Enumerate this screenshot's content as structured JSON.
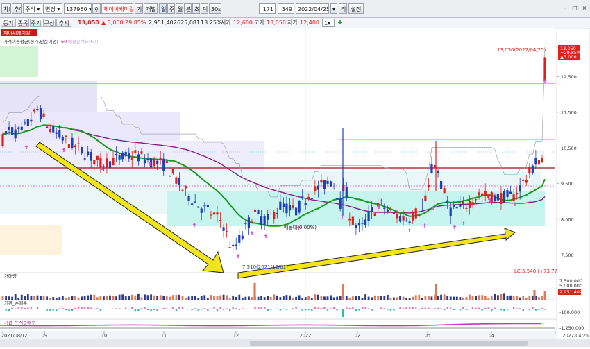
{
  "toolbar": {
    "left_buttons": [
      "차트",
      "추이"
    ],
    "market_select": "주식",
    "change_select": "변경",
    "code": "137950",
    "company": "제이씨케미칼",
    "period_buttons": [
      "기",
      "개별",
      "일",
      "주",
      "월",
      "분",
      "초",
      "틱",
      "30s"
    ],
    "count_value": "171",
    "visible_count": "349",
    "date": "2022/04/25",
    "menu": [
      "리",
      "설정"
    ]
  },
  "quote_bar": {
    "tabs": [
      "동기화",
      "종목",
      "주기",
      "구성",
      "추세선"
    ],
    "price_label": "13,050",
    "change": "3,000",
    "change_pct": "29.85%",
    "volume": "2,951,402",
    "amount": "625,081",
    "turnover": "13.25%",
    "open_label": "시가",
    "open": "12,600",
    "high_label": "고가",
    "high": "13,050",
    "low_label": "저가",
    "low": "12,400",
    "unit_value": "1"
  },
  "chart": {
    "title_label": "제이씨케미칼",
    "ma_legend": "가격이동평균(종가,단순이평)",
    "ma_legend_suffix": "60",
    "legend_faded": "매물분석도(60)",
    "high_annotation": "13,050(2022/04/25)",
    "current_box": [
      "13,050",
      "+29.85%",
      "▲3,000"
    ],
    "low_annotation": "7,510(2021/12/01)",
    "mid_annotation": "매물대(0.00%)",
    "lc_annotation": "LC:5,540 (+73.77%)",
    "price_ticks": [
      "12,500",
      "11,500",
      "10,500",
      "9,500",
      "8,500",
      "7,500"
    ],
    "volume_label": "거래량",
    "volume_ticks": [
      "7,500,000",
      "5,000,000",
      "2,951,402"
    ],
    "foreign_label": "기관_순매수",
    "foreign_ticks": [
      "-100,000"
    ],
    "program_label": "기관_누적순매수",
    "program_ticks": [
      "-1,250,000"
    ],
    "date_ticks": [
      "2021/08/12",
      "09",
      "10",
      "11",
      "12",
      "2022",
      "02",
      "03",
      "04",
      "2022/04/25"
    ],
    "colors": {
      "up": "#e0201b",
      "down": "#1f3fb8",
      "ma_fast": "#169a1c",
      "ma_slow": "#8a1b86",
      "arrow": "#f2e41a"
    }
  },
  "chart_data": {
    "type": "candlestick",
    "ylim": [
      7000,
      13700
    ],
    "series": [
      {
        "name": "60",
        "values": []
      }
    ],
    "x": [
      "2021/08/12",
      "2022/04/25"
    ],
    "last_close": 13050,
    "low": 7510,
    "high": 13050
  }
}
